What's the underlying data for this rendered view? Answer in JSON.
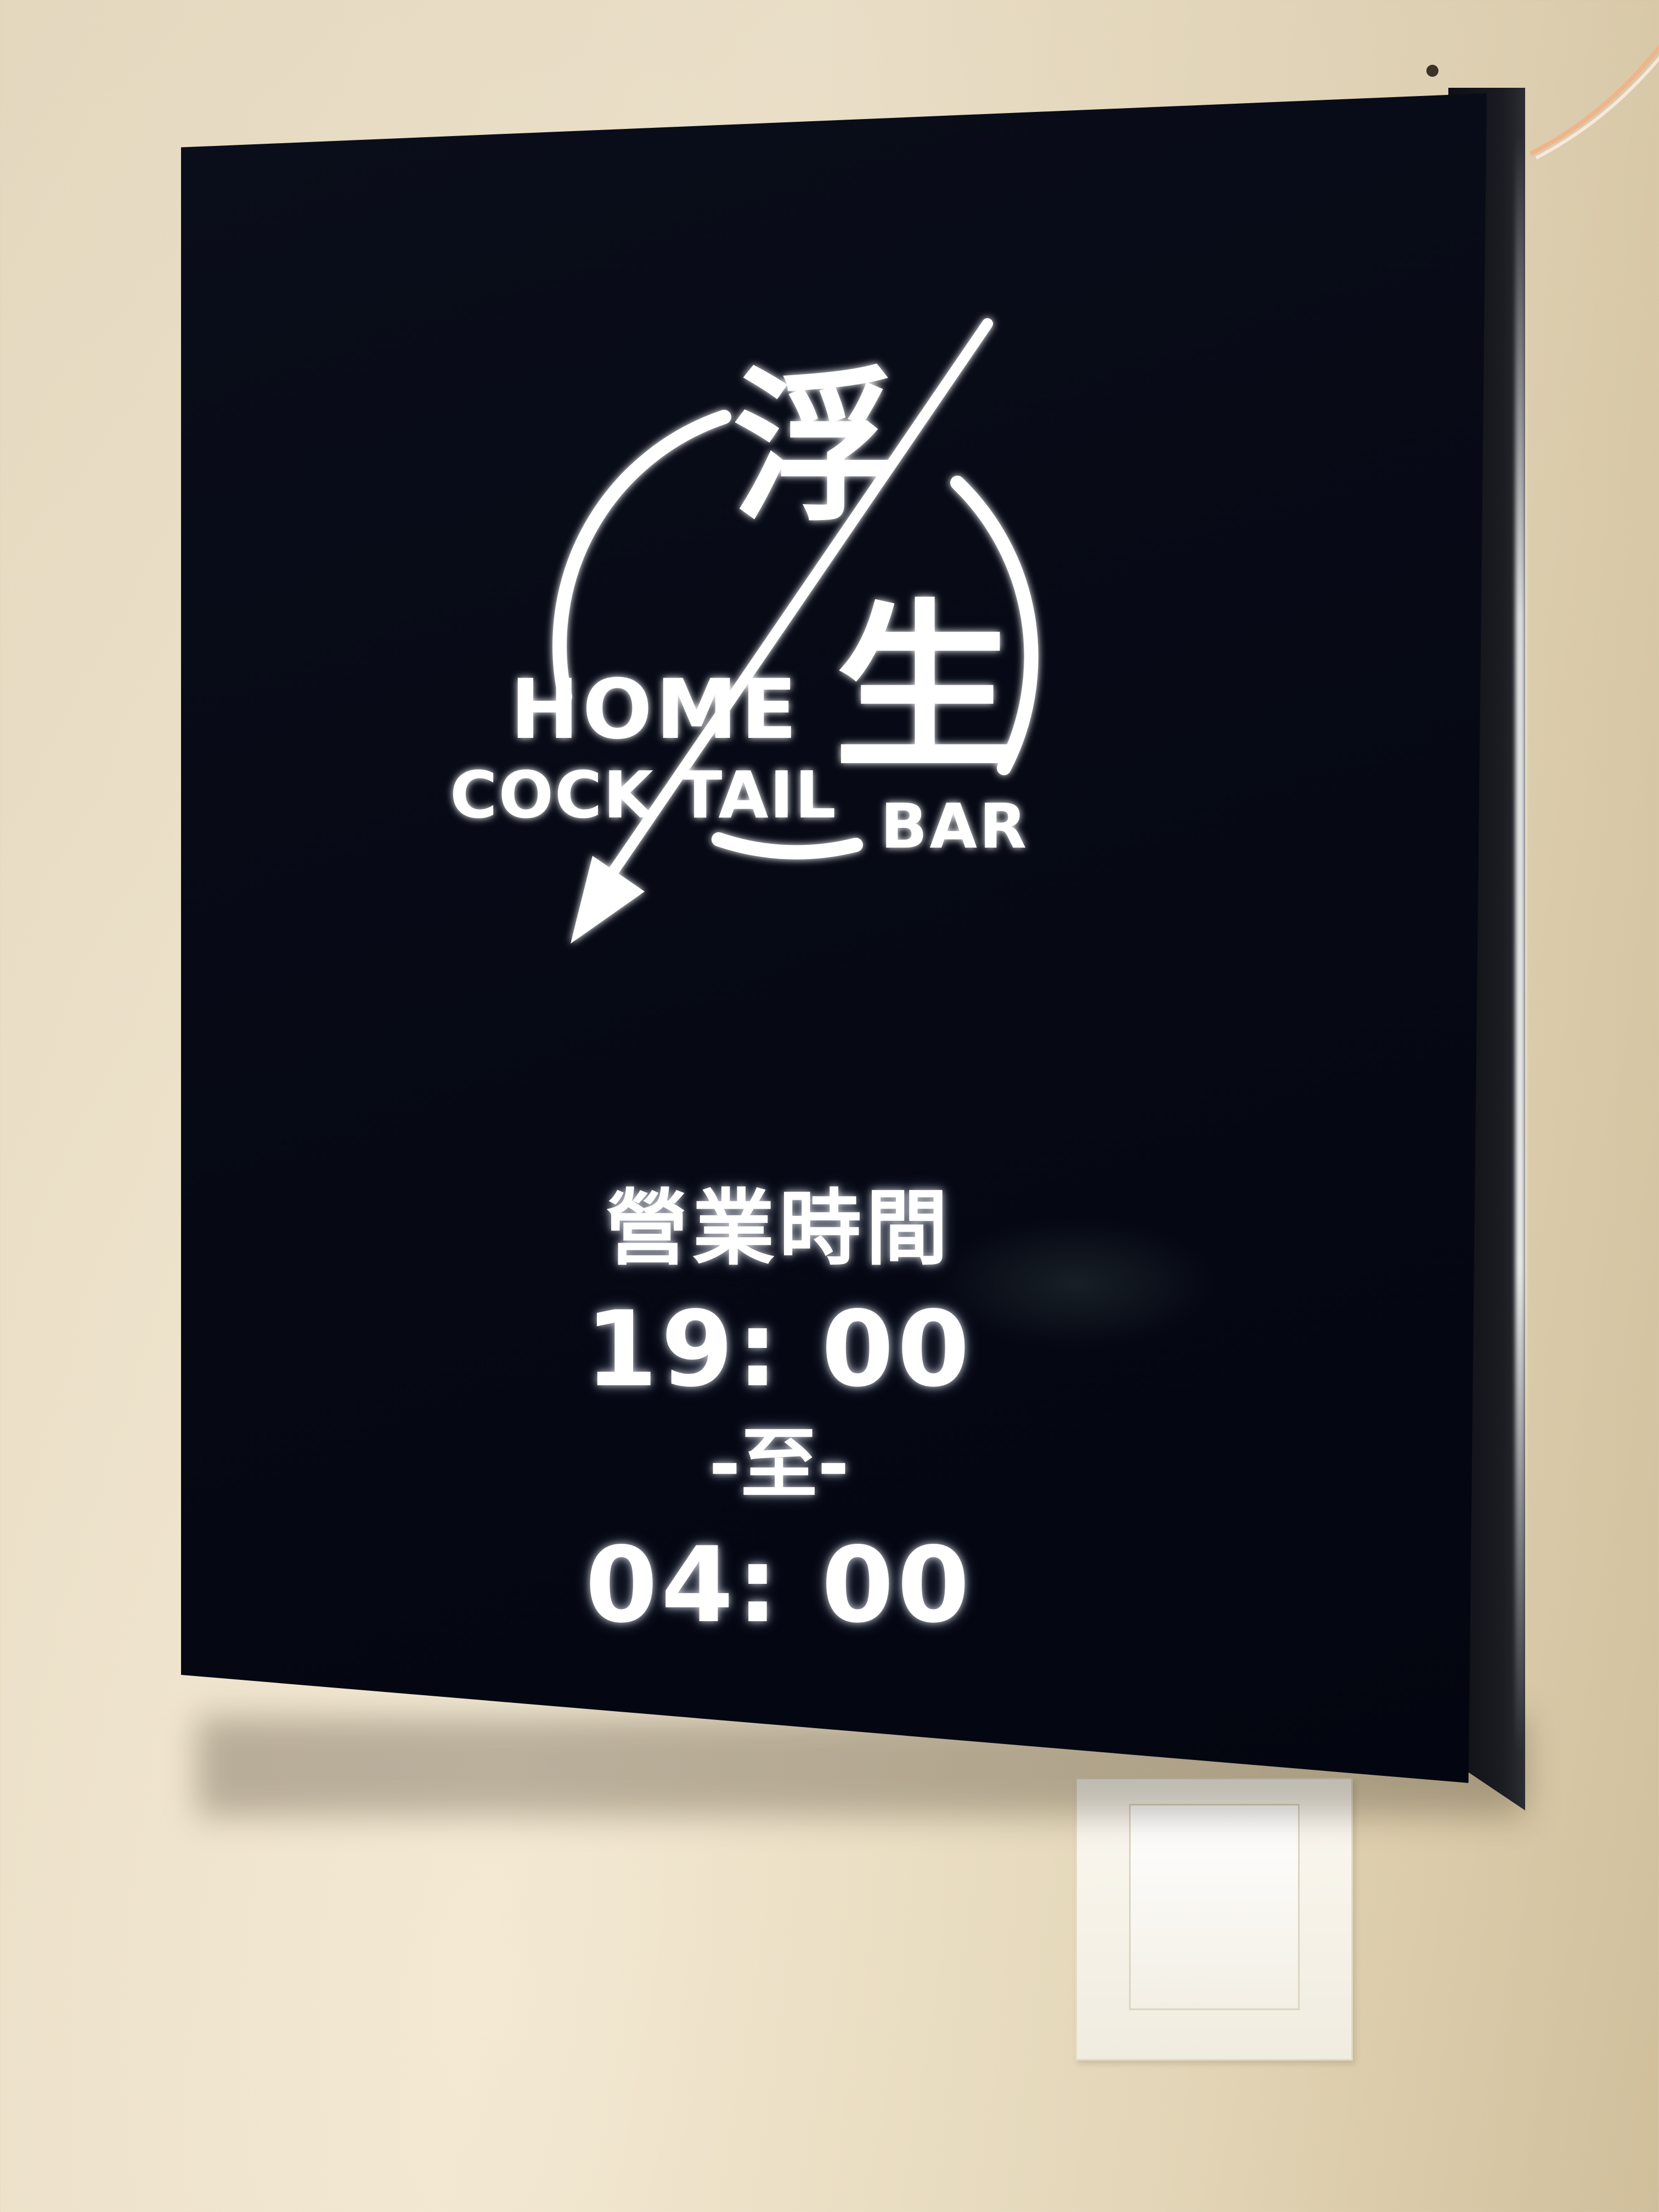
{
  "sign": {
    "logo": {
      "chinese_top": "浮",
      "chinese_bottom": "生",
      "word_home": "HOME",
      "word_cocktail": "COCK TAIL",
      "word_bar": "BAR"
    },
    "hours": {
      "title": "營業時間",
      "open_time": "19: 00",
      "separator": "-至-",
      "close_time": "04: 00"
    }
  },
  "colors": {
    "sign_face": "#060914",
    "light_text": "#ffffff",
    "wall": "#f0e5cd"
  }
}
